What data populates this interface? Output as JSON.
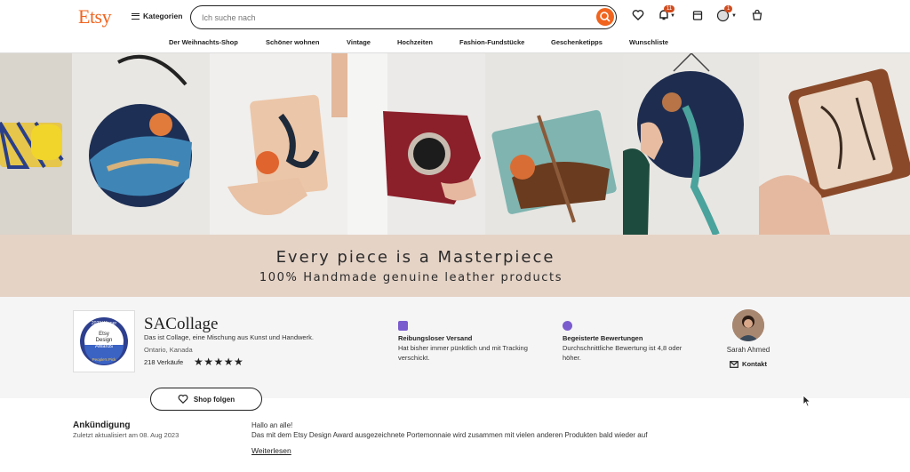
{
  "header": {
    "logo": "Etsy",
    "categories_label": "Kategorien",
    "search_placeholder": "Ich suche nach",
    "notifications_count": "11",
    "account_count": "1"
  },
  "subnav": {
    "items": [
      "Der Weihnachts-Shop",
      "Schöner wohnen",
      "Vintage",
      "Hochzeiten",
      "Fashion-Fundstücke",
      "Geschenketipps",
      "Wunschliste"
    ]
  },
  "banner": {
    "tagline": "Every piece is a Masterpiece",
    "subtitle": "100% Handmade genuine leather products"
  },
  "shop": {
    "badge_year": "2023 Winner",
    "badge_title": "Etsy Design Awards",
    "badge_sub": "People's Pick",
    "name": "SACollage",
    "description": "Das ist Collage, eine Mischung aus Kunst und Handwerk.",
    "location": "Ontario, Kanada",
    "sales": "218 Verkäufe",
    "rating": 5,
    "stars": "★★★★★",
    "features": [
      {
        "title": "Reibungsloser Versand",
        "desc": "Hat bisher immer pünktlich und mit Tracking verschickt."
      },
      {
        "title": "Begeisterte Bewertungen",
        "desc": "Durchschnittliche Bewertung ist 4,8 oder höher."
      }
    ],
    "owner_name": "Sarah Ahmed",
    "contact_label": "Kontakt",
    "follow_label": "Shop folgen"
  },
  "announcement": {
    "title": "Ankündigung",
    "updated": "Zuletzt aktualisiert am 08. Aug 2023",
    "line1": "Hallo an alle!",
    "line2": "Das mit dem Etsy Design Award ausgezeichnete Portemonnaie wird zusammen mit vielen anderen Produkten bald wieder auf",
    "more_label": "Weiterlesen"
  },
  "colors": {
    "brand": "#f1641e",
    "accent_purple": "#7b5cce",
    "strip": "#e5d3c6"
  }
}
